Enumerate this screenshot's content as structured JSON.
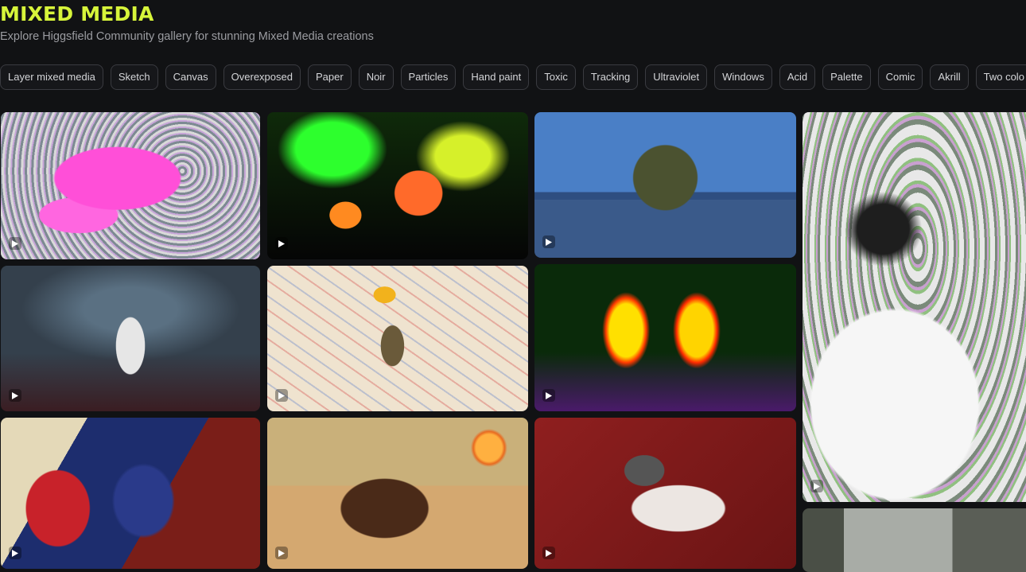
{
  "header": {
    "title": "MIXED MEDIA",
    "subtitle": "Explore Higgsfield Community gallery for stunning Mixed Media creations"
  },
  "filters": [
    "Layer mixed media",
    "Sketch",
    "Canvas",
    "Overexposed",
    "Paper",
    "Noir",
    "Particles",
    "Hand paint",
    "Toxic",
    "Tracking",
    "Ultraviolet",
    "Windows",
    "Acid",
    "Palette",
    "Comic",
    "Akrill",
    "Two colo"
  ],
  "gallery": {
    "tiles": [
      {
        "id": "pink-dancer",
        "colors": [
          "#e85bd1",
          "#9aa0a6"
        ]
      },
      {
        "id": "neon-night-crew",
        "colors": [
          "#2bdc2b",
          "#1b1405"
        ]
      },
      {
        "id": "man-on-container",
        "colors": [
          "#4a7fc6",
          "#3f4a2a"
        ]
      },
      {
        "id": "overexposed-subway",
        "colors": [
          "#f2f2f2",
          "#2d2d2d"
        ]
      },
      {
        "id": "noir-cage-figure",
        "colors": [
          "#3b4a5c",
          "#2a1a1c"
        ]
      },
      {
        "id": "skater-doodles",
        "colors": [
          "#efe3cf",
          "#d04545"
        ]
      },
      {
        "id": "thermal-couple",
        "colors": [
          "#ffd400",
          "#5a1a7a"
        ]
      },
      {
        "id": "comic-hoodies",
        "colors": [
          "#c8222a",
          "#1d2d6e"
        ]
      },
      {
        "id": "cowboy-horse",
        "colors": [
          "#c9a470",
          "#5a3a22"
        ]
      },
      {
        "id": "red-couch-man",
        "colors": [
          "#8a1c1c",
          "#e6e0dc"
        ]
      },
      {
        "id": "alley-street",
        "colors": [
          "#8a8f8a",
          "#3a3f3a"
        ]
      }
    ]
  }
}
